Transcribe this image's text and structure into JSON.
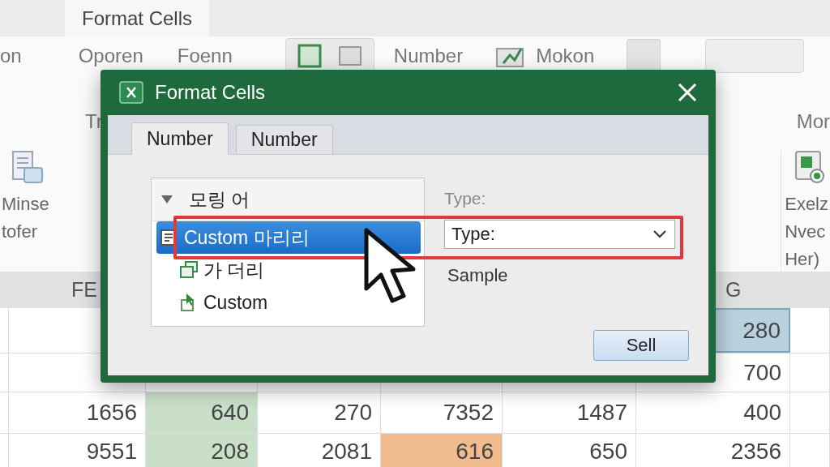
{
  "app_tabs": [
    {
      "label": "Format Cells",
      "selected": true
    }
  ],
  "ribbon": {
    "row_1": [
      {
        "label": "on",
        "kind": "text"
      },
      {
        "label": "Oporen",
        "kind": "text"
      },
      {
        "label": "Foenn",
        "kind": "text"
      },
      {
        "label": "Number",
        "kind": "icons"
      },
      {
        "label": "Mokon",
        "kind": "chart"
      },
      {
        "kind": "square"
      },
      {
        "kind": "field"
      }
    ],
    "row_2": [
      "Tr",
      "Mor"
    ],
    "left_command": {
      "lines": [
        "Minse",
        "tofer"
      ]
    },
    "right_command": {
      "lines": [
        "Exelz",
        "Nvec",
        "Her)"
      ]
    }
  },
  "sheet": {
    "columns": [
      "FE",
      "",
      "",
      "",
      "",
      "G"
    ],
    "rows": [
      {
        "cells": [
          {},
          {},
          {},
          {},
          {},
          {
            "text": "280",
            "color": "#b9d0df"
          }
        ]
      },
      {
        "cells": [
          {},
          {},
          {},
          {},
          {},
          {
            "text": "700"
          }
        ]
      },
      {
        "cells": [
          {
            "text": "1656"
          },
          {
            "text": "640",
            "color": "#c9dfc8"
          },
          {
            "text": "270"
          },
          {
            "text": "7352",
            "color": "#ffffff"
          },
          {
            "text": "1487"
          },
          {
            "text": "400"
          }
        ]
      },
      {
        "cells": [
          {
            "text": "9551"
          },
          {
            "text": "208",
            "color": "#c9dfc8"
          },
          {
            "text": "2081"
          },
          {
            "text": "616",
            "color": "#f0bb8d"
          },
          {
            "text": "650"
          },
          {
            "text": "2356"
          }
        ]
      }
    ]
  },
  "dialog": {
    "title": "Format Cells",
    "tabs": [
      {
        "label": "Number",
        "selected": true
      },
      {
        "label": "Number",
        "selected": false
      }
    ],
    "tree": {
      "label": "모링 어",
      "expanded": true,
      "children": [
        {
          "label": "Custom 마리리",
          "kind": "list",
          "selected": true
        },
        {
          "label": "가 더리",
          "kind": "copy",
          "selected": false
        },
        {
          "label": "Custom",
          "kind": "custom",
          "selected": false
        }
      ]
    },
    "type_label": "Type:",
    "type_select": {
      "value": "Type:"
    },
    "sample_label": "Sample",
    "buttons": [
      "Sell"
    ]
  }
}
